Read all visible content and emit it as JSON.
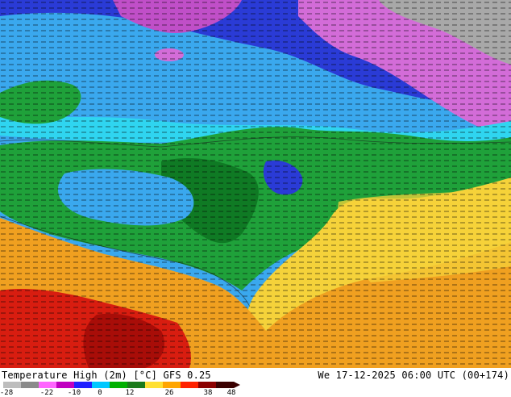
{
  "map": {
    "title": "Temperature High (2m) [°C] GFS 0.25",
    "datetime": "We 17-12-2025 06:00 UTC (00+174)"
  },
  "legend": {
    "ticks": [
      "-28",
      "-22",
      "-10",
      "0",
      "12",
      "26",
      "38",
      "48"
    ],
    "colors": [
      "#bdbdbd",
      "#8a8a8a",
      "#ff66ff",
      "#c000c0",
      "#2020ff",
      "#00c8ff",
      "#00b000",
      "#1a7a1a",
      "#ffe033",
      "#ffa500",
      "#ff2200",
      "#8b0000",
      "#3a0000"
    ]
  },
  "palette": {
    "polar": "#a8a8a8",
    "magenta": "#d36cd8",
    "deep_blue": "#2a3bd6",
    "light_blue": "#3aa8ee",
    "cyan": "#2fd5f0",
    "green": "#1fa13a",
    "dark_green": "#0f7a24",
    "yellow": "#f5d23a",
    "orange": "#f0a020",
    "red": "#d81d10"
  }
}
